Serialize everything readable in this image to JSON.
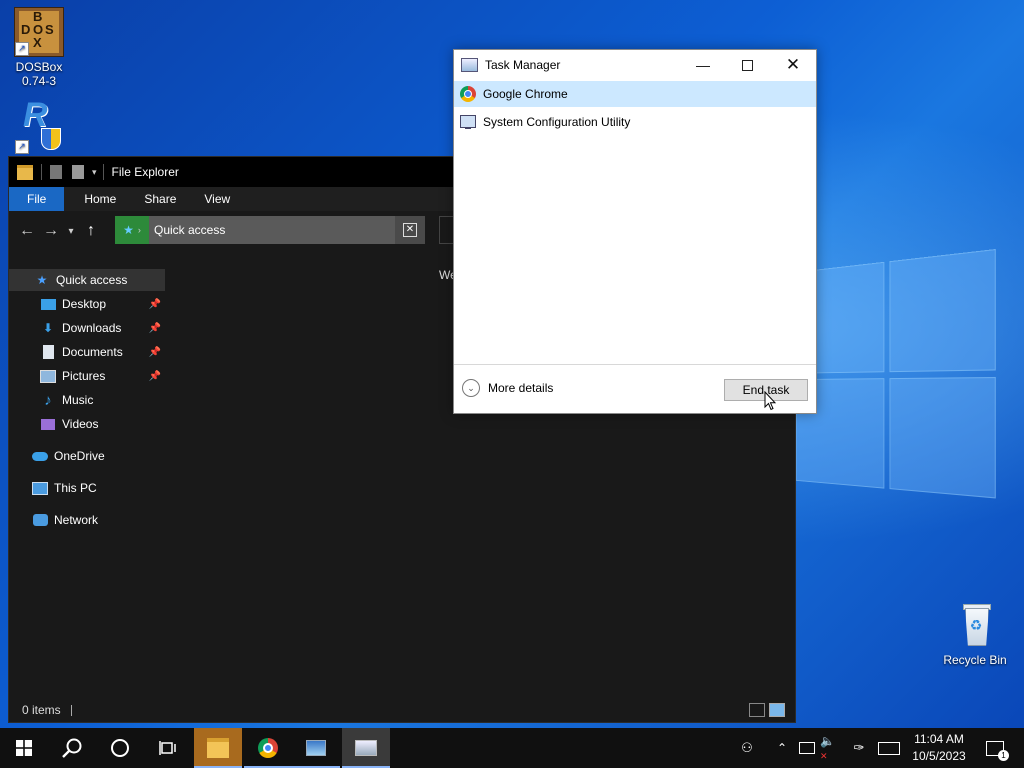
{
  "desktop": {
    "icons": [
      {
        "label": "DOSBox\n0.74-3",
        "line1": "DOSBox",
        "line2": "0.74-3"
      },
      {
        "label": "",
        "line1": "",
        "line2": ""
      },
      {
        "label": "Recycle Bin",
        "line1": "Recycle Bin",
        "line2": ""
      }
    ],
    "dosbox_letters": [
      "B",
      "D",
      "O",
      "S",
      "X"
    ]
  },
  "explorer": {
    "title": "File Explorer",
    "ribbon_tabs": [
      "File",
      "Home",
      "Share",
      "View"
    ],
    "address": "Quick access",
    "sidebar": [
      {
        "label": "Quick access",
        "icon": "star-icon",
        "pinned": false
      },
      {
        "label": "Desktop",
        "icon": "desktop-folder-icon",
        "pinned": true
      },
      {
        "label": "Downloads",
        "icon": "download-icon",
        "pinned": true
      },
      {
        "label": "Documents",
        "icon": "document-icon",
        "pinned": true
      },
      {
        "label": "Pictures",
        "icon": "pictures-icon",
        "pinned": true
      },
      {
        "label": "Music",
        "icon": "music-icon",
        "pinned": false
      },
      {
        "label": "Videos",
        "icon": "video-icon",
        "pinned": false
      },
      {
        "label": "OneDrive",
        "icon": "cloud-icon",
        "pinned": false
      },
      {
        "label": "This PC",
        "icon": "computer-icon",
        "pinned": false
      },
      {
        "label": "Network",
        "icon": "network-icon",
        "pinned": false
      }
    ],
    "main_partial_text": "We",
    "status": "0 items"
  },
  "taskmgr": {
    "title": "Task Manager",
    "apps": [
      {
        "label": "Google Chrome",
        "icon": "chrome-icon",
        "selected": true
      },
      {
        "label": "System Configuration Utility",
        "icon": "msconfig-icon",
        "selected": false
      }
    ],
    "more_details": "More details",
    "end_task": "End task"
  },
  "taskbar": {
    "time": "11:04 AM",
    "date": "10/5/2023",
    "notification_count": "1"
  },
  "colors": {
    "accent": "#1a68c4",
    "selection": "#cce8ff",
    "taskbar": "#101010"
  }
}
